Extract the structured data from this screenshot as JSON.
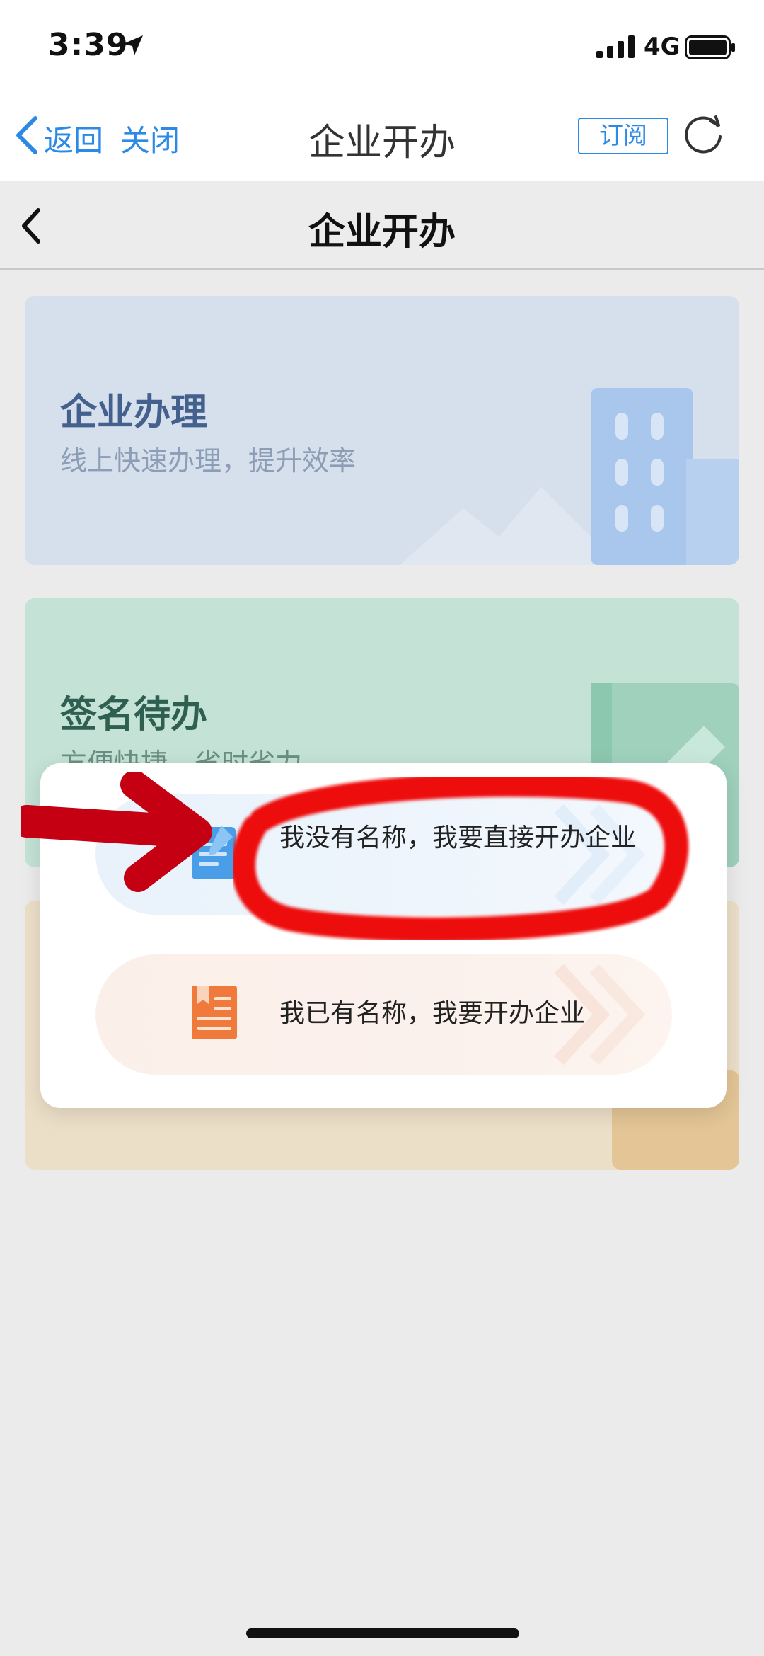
{
  "status_bar": {
    "time": "3:39",
    "network": "4G",
    "icons": [
      "location-arrow-icon",
      "signal-bars-icon",
      "battery-icon"
    ]
  },
  "nav_bar": {
    "back_label": "返回",
    "close_label": "关闭",
    "title": "企业开办",
    "subscribe_label": "订阅",
    "icons": [
      "back-chevron-icon",
      "refresh-icon"
    ]
  },
  "page_header": {
    "title": "企业开办",
    "icons": [
      "back-chevron-icon"
    ]
  },
  "cards": [
    {
      "title": "企业办理",
      "subtitle": "线上快速办理，提升效率",
      "color": "#d6dfec"
    },
    {
      "title": "签名待办",
      "subtitle": "方便快捷，省时省力",
      "color": "#c4e2d6"
    },
    {
      "title": "",
      "subtitle": "",
      "color": "#ecdfc8"
    }
  ],
  "modal": {
    "options": [
      {
        "label": "我没有名称，我要直接开办企业",
        "icon": "document-edit-icon",
        "color": "#4a9ee8"
      },
      {
        "label": "我已有名称，我要开办企业",
        "icon": "bookmark-document-icon",
        "color": "#f07a3c"
      }
    ]
  },
  "annotations": {
    "highlight_color": "#ee1111",
    "arrow_color": "#c40012"
  }
}
